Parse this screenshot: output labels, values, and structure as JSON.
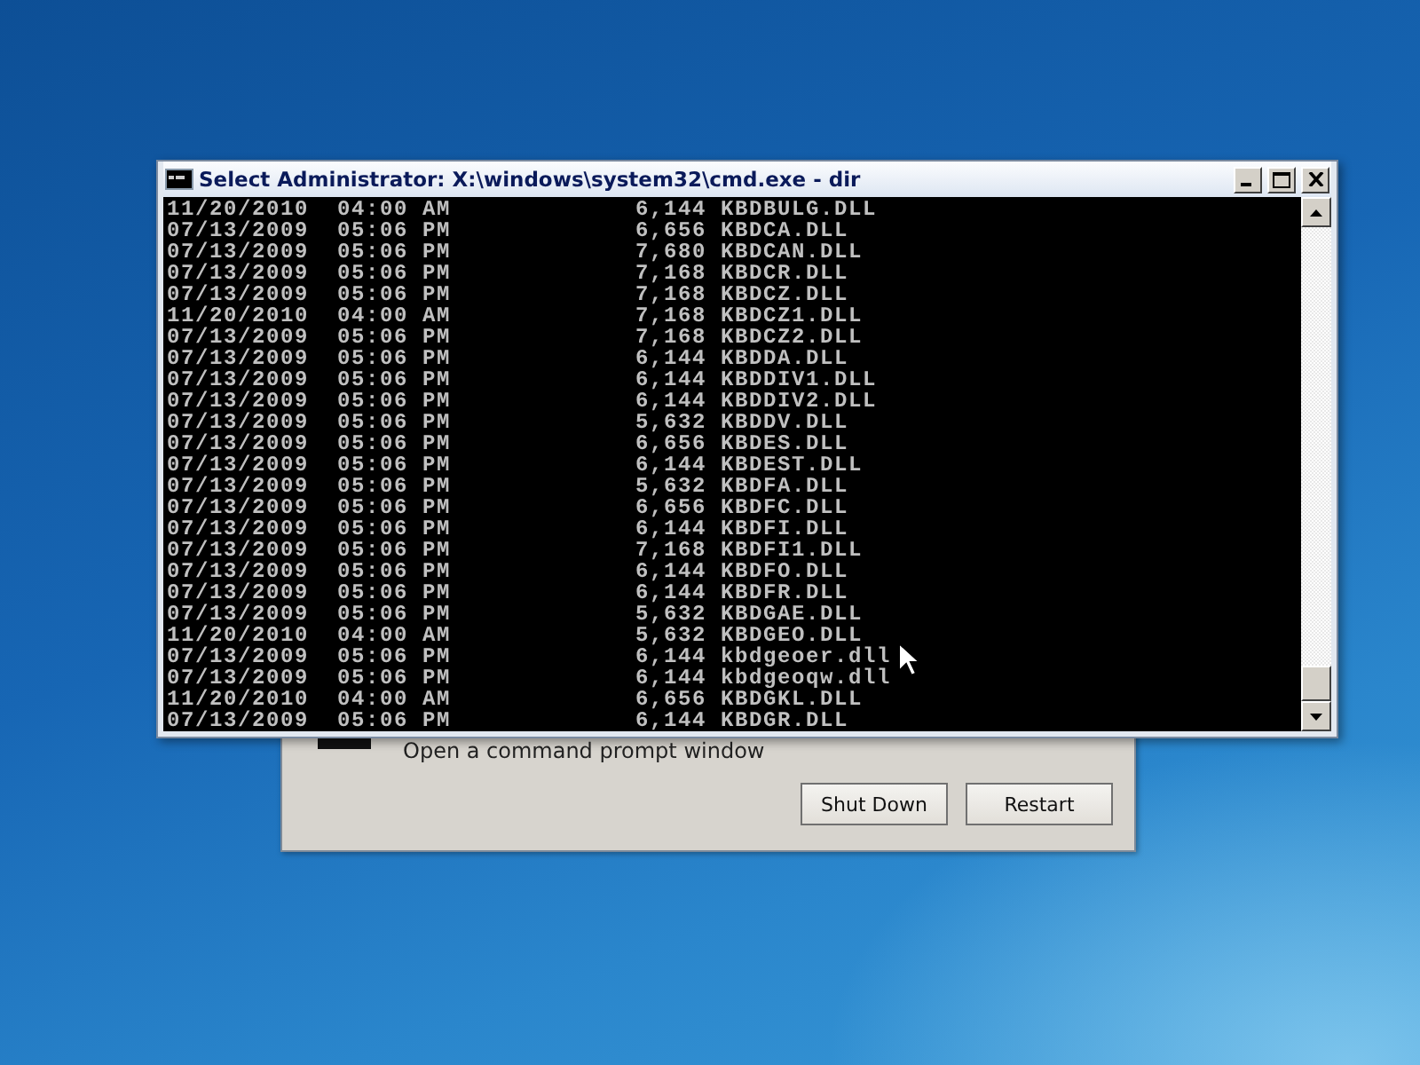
{
  "dialog": {
    "option_text": "Open a command prompt window",
    "buttons": [
      {
        "label": "Shut Down"
      },
      {
        "label": "Restart"
      }
    ]
  },
  "console_window": {
    "title": "Select Administrator: X:\\windows\\system32\\cmd.exe - dir",
    "rows": [
      {
        "date": "11/20/2010",
        "time": "04:00",
        "ampm": "AM",
        "size": "6,144",
        "name": "KBDBULG.DLL"
      },
      {
        "date": "07/13/2009",
        "time": "05:06",
        "ampm": "PM",
        "size": "6,656",
        "name": "KBDCA.DLL"
      },
      {
        "date": "07/13/2009",
        "time": "05:06",
        "ampm": "PM",
        "size": "7,680",
        "name": "KBDCAN.DLL"
      },
      {
        "date": "07/13/2009",
        "time": "05:06",
        "ampm": "PM",
        "size": "7,168",
        "name": "KBDCR.DLL"
      },
      {
        "date": "07/13/2009",
        "time": "05:06",
        "ampm": "PM",
        "size": "7,168",
        "name": "KBDCZ.DLL"
      },
      {
        "date": "11/20/2010",
        "time": "04:00",
        "ampm": "AM",
        "size": "7,168",
        "name": "KBDCZ1.DLL"
      },
      {
        "date": "07/13/2009",
        "time": "05:06",
        "ampm": "PM",
        "size": "7,168",
        "name": "KBDCZ2.DLL"
      },
      {
        "date": "07/13/2009",
        "time": "05:06",
        "ampm": "PM",
        "size": "6,144",
        "name": "KBDDA.DLL"
      },
      {
        "date": "07/13/2009",
        "time": "05:06",
        "ampm": "PM",
        "size": "6,144",
        "name": "KBDDIV1.DLL"
      },
      {
        "date": "07/13/2009",
        "time": "05:06",
        "ampm": "PM",
        "size": "6,144",
        "name": "KBDDIV2.DLL"
      },
      {
        "date": "07/13/2009",
        "time": "05:06",
        "ampm": "PM",
        "size": "5,632",
        "name": "KBDDV.DLL"
      },
      {
        "date": "07/13/2009",
        "time": "05:06",
        "ampm": "PM",
        "size": "6,656",
        "name": "KBDES.DLL"
      },
      {
        "date": "07/13/2009",
        "time": "05:06",
        "ampm": "PM",
        "size": "6,144",
        "name": "KBDEST.DLL"
      },
      {
        "date": "07/13/2009",
        "time": "05:06",
        "ampm": "PM",
        "size": "5,632",
        "name": "KBDFA.DLL"
      },
      {
        "date": "07/13/2009",
        "time": "05:06",
        "ampm": "PM",
        "size": "6,656",
        "name": "KBDFC.DLL"
      },
      {
        "date": "07/13/2009",
        "time": "05:06",
        "ampm": "PM",
        "size": "6,144",
        "name": "KBDFI.DLL"
      },
      {
        "date": "07/13/2009",
        "time": "05:06",
        "ampm": "PM",
        "size": "7,168",
        "name": "KBDFI1.DLL"
      },
      {
        "date": "07/13/2009",
        "time": "05:06",
        "ampm": "PM",
        "size": "6,144",
        "name": "KBDFO.DLL"
      },
      {
        "date": "07/13/2009",
        "time": "05:06",
        "ampm": "PM",
        "size": "6,144",
        "name": "KBDFR.DLL"
      },
      {
        "date": "07/13/2009",
        "time": "05:06",
        "ampm": "PM",
        "size": "5,632",
        "name": "KBDGAE.DLL"
      },
      {
        "date": "11/20/2010",
        "time": "04:00",
        "ampm": "AM",
        "size": "5,632",
        "name": "KBDGEO.DLL"
      },
      {
        "date": "07/13/2009",
        "time": "05:06",
        "ampm": "PM",
        "size": "6,144",
        "name": "kbdgeoer.dll"
      },
      {
        "date": "07/13/2009",
        "time": "05:06",
        "ampm": "PM",
        "size": "6,144",
        "name": "kbdgeoqw.dll"
      },
      {
        "date": "11/20/2010",
        "time": "04:00",
        "ampm": "AM",
        "size": "6,656",
        "name": "KBDGKL.DLL"
      },
      {
        "date": "07/13/2009",
        "time": "05:06",
        "ampm": "PM",
        "size": "6,144",
        "name": "KBDGR.DLL"
      }
    ]
  }
}
